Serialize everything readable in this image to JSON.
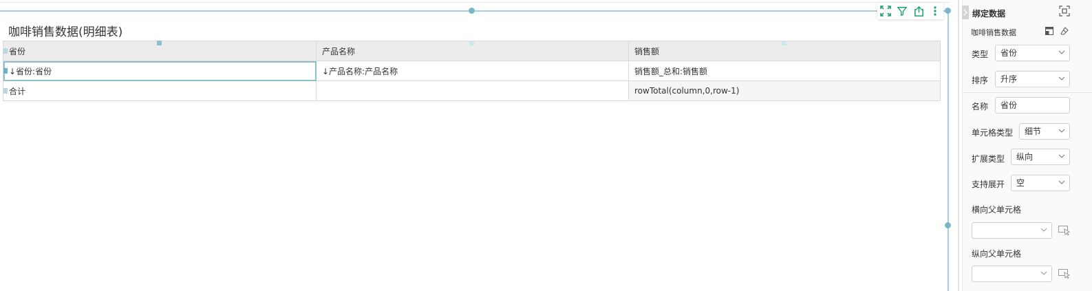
{
  "report": {
    "title": "咖啡销售数据(明细表)",
    "headers": [
      "省份",
      "产品名称",
      "销售额"
    ],
    "detail_row": [
      "↓省份:省份",
      "↓产品名称:产品名称",
      "销售额_总和:销售额"
    ],
    "total_row": [
      "合计",
      "",
      "rowTotal(column,0,row-1)"
    ]
  },
  "toolbar": {
    "icons": [
      "fullscreen-icon",
      "filter-icon",
      "export-icon",
      "more-icon"
    ]
  },
  "panel": {
    "title": "绑定数据",
    "dataset_name": "咖啡销售数据",
    "type_label": "类型",
    "type_value": "省份",
    "sort_label": "排序",
    "sort_value": "升序",
    "name_label": "名称",
    "name_value": "省份",
    "cell_type_label": "单元格类型",
    "cell_type_value": "细节",
    "expand_type_label": "扩展类型",
    "expand_type_value": "纵向",
    "support_expand_label": "支持展开",
    "support_expand_value": "空",
    "h_parent_label": "横向父单元格",
    "h_parent_value": "",
    "v_parent_label": "纵向父单元格",
    "v_parent_value": ""
  },
  "colors": {
    "accent": "#1aa36b",
    "selection": "#8fbfcf",
    "header_bg": "#ececec"
  }
}
